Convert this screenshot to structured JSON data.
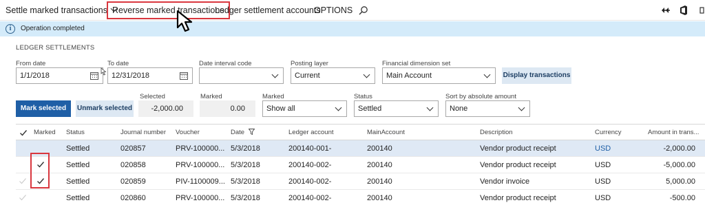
{
  "toolbar": {
    "settle_label": "Settle marked transactions",
    "reverse_label": "Reverse marked transactions",
    "ledger_label": "Ledger settlement accounts",
    "options_label": "OPTIONS"
  },
  "banner": {
    "message": "Operation completed"
  },
  "section": {
    "title": "LEDGER SETTLEMENTS"
  },
  "filters": {
    "from_date_label": "From date",
    "from_date": "1/1/2018",
    "to_date_label": "To date",
    "to_date": "12/31/2018",
    "date_interval_label": "Date interval code",
    "date_interval": "",
    "posting_layer_label": "Posting layer",
    "posting_layer": "Current",
    "dimension_set_label": "Financial dimension set",
    "dimension_set": "Main Account",
    "display_button": "Display transactions"
  },
  "summary": {
    "mark_selected": "Mark selected",
    "unmark_selected": "Unmark selected",
    "selected_label": "Selected",
    "selected_value": "-2,000.00",
    "marked_label": "Marked",
    "marked_value": "0.00",
    "marked_filter_label": "Marked",
    "marked_filter": "Show all",
    "status_label": "Status",
    "status": "Settled",
    "sort_label": "Sort by absolute amount",
    "sort": "None"
  },
  "grid": {
    "headers": [
      "Marked",
      "Status",
      "Journal number",
      "Voucher",
      "Date",
      "Ledger account",
      "MainAccount",
      "Description",
      "Currency",
      "Amount in trans..."
    ],
    "rows": [
      {
        "marked": false,
        "status": "Settled",
        "journal": "020857",
        "voucher": "PRV-100000...",
        "date": "5/3/2018",
        "ledger": "200140-001-",
        "main": "200140",
        "desc": "Vendor product receipt",
        "currency": "USD",
        "amount": "-2,000.00"
      },
      {
        "marked": true,
        "status": "Settled",
        "journal": "020858",
        "voucher": "PRV-100000...",
        "date": "5/3/2018",
        "ledger": "200140-002-",
        "main": "200140",
        "desc": "Vendor product receipt",
        "currency": "USD",
        "amount": "-5,000.00"
      },
      {
        "marked": true,
        "status": "Settled",
        "journal": "020859",
        "voucher": "PIV-1100009...",
        "date": "5/3/2018",
        "ledger": "200140-002-",
        "main": "200140",
        "desc": "Vendor invoice",
        "currency": "USD",
        "amount": "5,000.00"
      },
      {
        "marked": false,
        "status": "Settled",
        "journal": "020860",
        "voucher": "PRV-100000...",
        "date": "5/3/2018",
        "ledger": "200140-002-",
        "main": "200140",
        "desc": "Vendor product receipt",
        "currency": "USD",
        "amount": "-500.00"
      }
    ]
  },
  "colors": {
    "accent": "#1f5fa6",
    "banner": "#d4ebfa",
    "highlight": "#d9363e",
    "selected_row": "#dfe9f5"
  }
}
